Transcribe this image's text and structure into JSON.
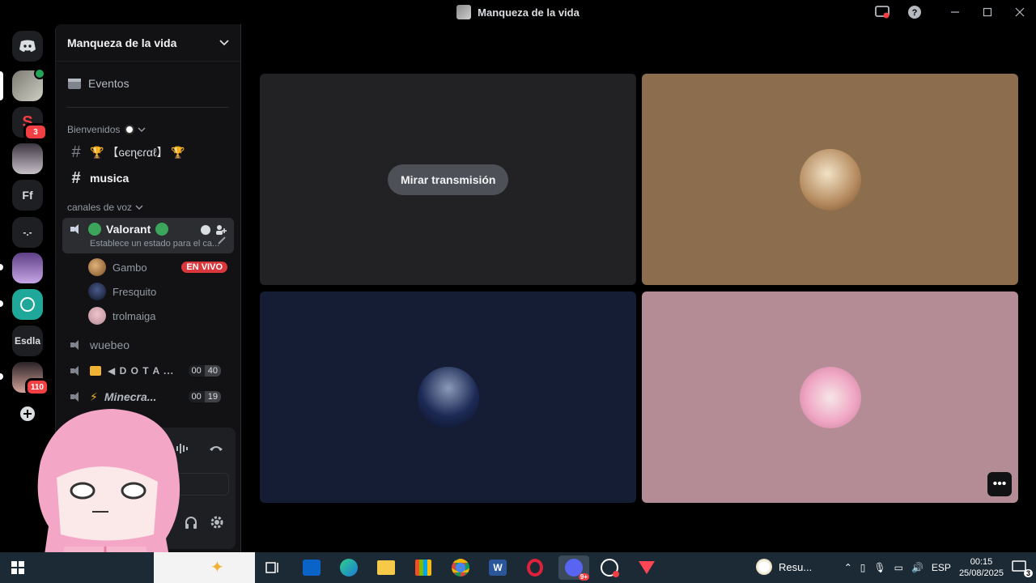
{
  "window": {
    "title": "Manqueza de la vida"
  },
  "rail": {
    "servers": [
      {
        "label": "",
        "badge": ""
      },
      {
        "label": "",
        "badge": "3"
      },
      {
        "label": "",
        "badge": ""
      },
      {
        "label": "Ff",
        "badge": ""
      },
      {
        "label": "-.-",
        "badge": ""
      },
      {
        "label": "",
        "badge": ""
      },
      {
        "label": "",
        "badge": ""
      },
      {
        "label": "Esdla",
        "badge": ""
      },
      {
        "label": "",
        "badge": "110"
      }
    ]
  },
  "sidebar": {
    "guild_name": "Manqueza de la vida",
    "events_label": "Eventos",
    "category_welcome": "Bienvenidos",
    "channel_general": "🏆 【ɢєɳєɾαℓ】 🏆",
    "channel_musica": "musica",
    "category_voice": "canales de voz",
    "active_voice": {
      "name": "Valorant",
      "status": "Establece un estado para el ca..."
    },
    "members": [
      {
        "name": "Gambo",
        "live": "EN VIVO"
      },
      {
        "name": "Fresquito",
        "live": ""
      },
      {
        "name": "trolmaiga",
        "live": ""
      }
    ],
    "voice_channels": [
      {
        "name": "wuebeo",
        "count_a": "",
        "count_b": ""
      },
      {
        "name": "◀ D O T A ...",
        "count_a": "00",
        "count_b": "40"
      },
      {
        "name": "Minecra...",
        "count_a": "00",
        "count_b": "19"
      }
    ],
    "voice_panel_label": "V"
  },
  "stage": {
    "watch_label": "Mirar transmisión",
    "more_label": "•••"
  },
  "taskbar": {
    "search_item": "Resu...",
    "lang": "ESP",
    "time": "00:15",
    "date": "25/08/2025",
    "notif_count": "3",
    "discord_badge": "9+"
  },
  "colors": {
    "tile_dark": "#222225",
    "tile_brown": "#8c6d4d",
    "tile_navy": "#141d33",
    "tile_pink": "#b48c96",
    "live_red": "#da373c"
  }
}
